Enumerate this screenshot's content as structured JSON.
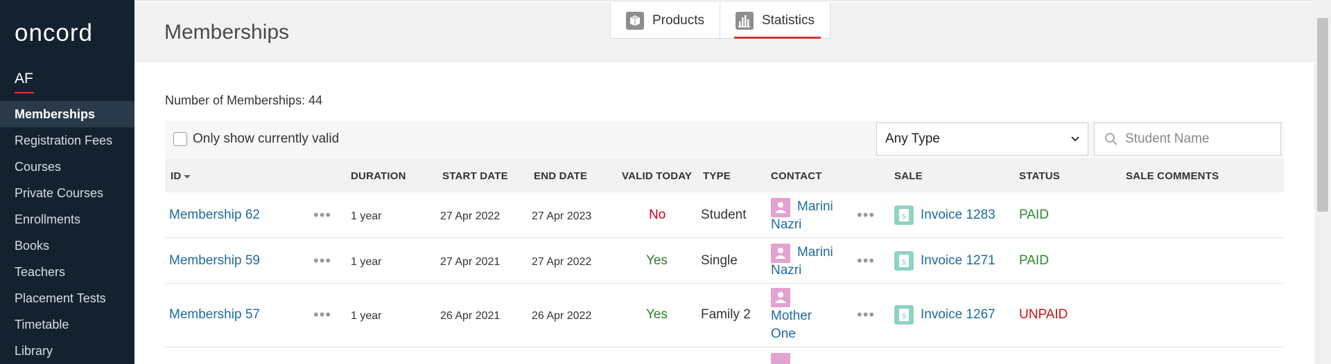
{
  "sidebar": {
    "logo": "oncord",
    "org": "AF",
    "items": [
      {
        "label": "Memberships",
        "active": true
      },
      {
        "label": "Registration Fees"
      },
      {
        "label": "Courses"
      },
      {
        "label": "Private Courses"
      },
      {
        "label": "Enrollments"
      },
      {
        "label": "Books"
      },
      {
        "label": "Teachers"
      },
      {
        "label": "Placement Tests"
      },
      {
        "label": "Timetable"
      },
      {
        "label": "Library"
      }
    ]
  },
  "header": {
    "title": "Memberships",
    "tabs": [
      {
        "label": "Products",
        "icon": "box-icon"
      },
      {
        "label": "Statistics",
        "icon": "bar-chart-icon",
        "active": true
      }
    ]
  },
  "summary": {
    "count_text": "Number of Memberships: 44"
  },
  "filters": {
    "only_valid_label": "Only show currently valid",
    "type_value": "Any Type",
    "search_placeholder": "Student Name"
  },
  "table": {
    "columns": [
      "ID",
      "DURATION",
      "START DATE",
      "END DATE",
      "VALID TODAY",
      "TYPE",
      "CONTACT",
      "SALE",
      "STATUS",
      "SALE COMMENTS"
    ],
    "rows": [
      {
        "id": "Membership 62",
        "duration": "1 year",
        "start": "27 Apr 2022",
        "end": "27 Apr 2023",
        "valid": "No",
        "type": "Student",
        "contact1": "Marini",
        "contact2": "Nazri",
        "sale": "Invoice 1283",
        "status": "PAID"
      },
      {
        "id": "Membership 59",
        "duration": "1 year",
        "start": "27 Apr 2021",
        "end": "27 Apr 2022",
        "valid": "Yes",
        "type": "Single",
        "contact1": "Marini",
        "contact2": "Nazri",
        "sale": "Invoice 1271",
        "status": "PAID"
      },
      {
        "id": "Membership 57",
        "duration": "1 year",
        "start": "26 Apr 2021",
        "end": "26 Apr 2022",
        "valid": "Yes",
        "type": "Family 2",
        "contact1": "Mother",
        "contact2": "One",
        "sale": "Invoice 1267",
        "status": "UNPAID"
      }
    ]
  },
  "colors": {
    "sidebar_bg": "#142230",
    "accent": "#e0312b",
    "link": "#1f6b9e",
    "paid": "#2e8b2e",
    "unpaid": "#cc1111"
  }
}
